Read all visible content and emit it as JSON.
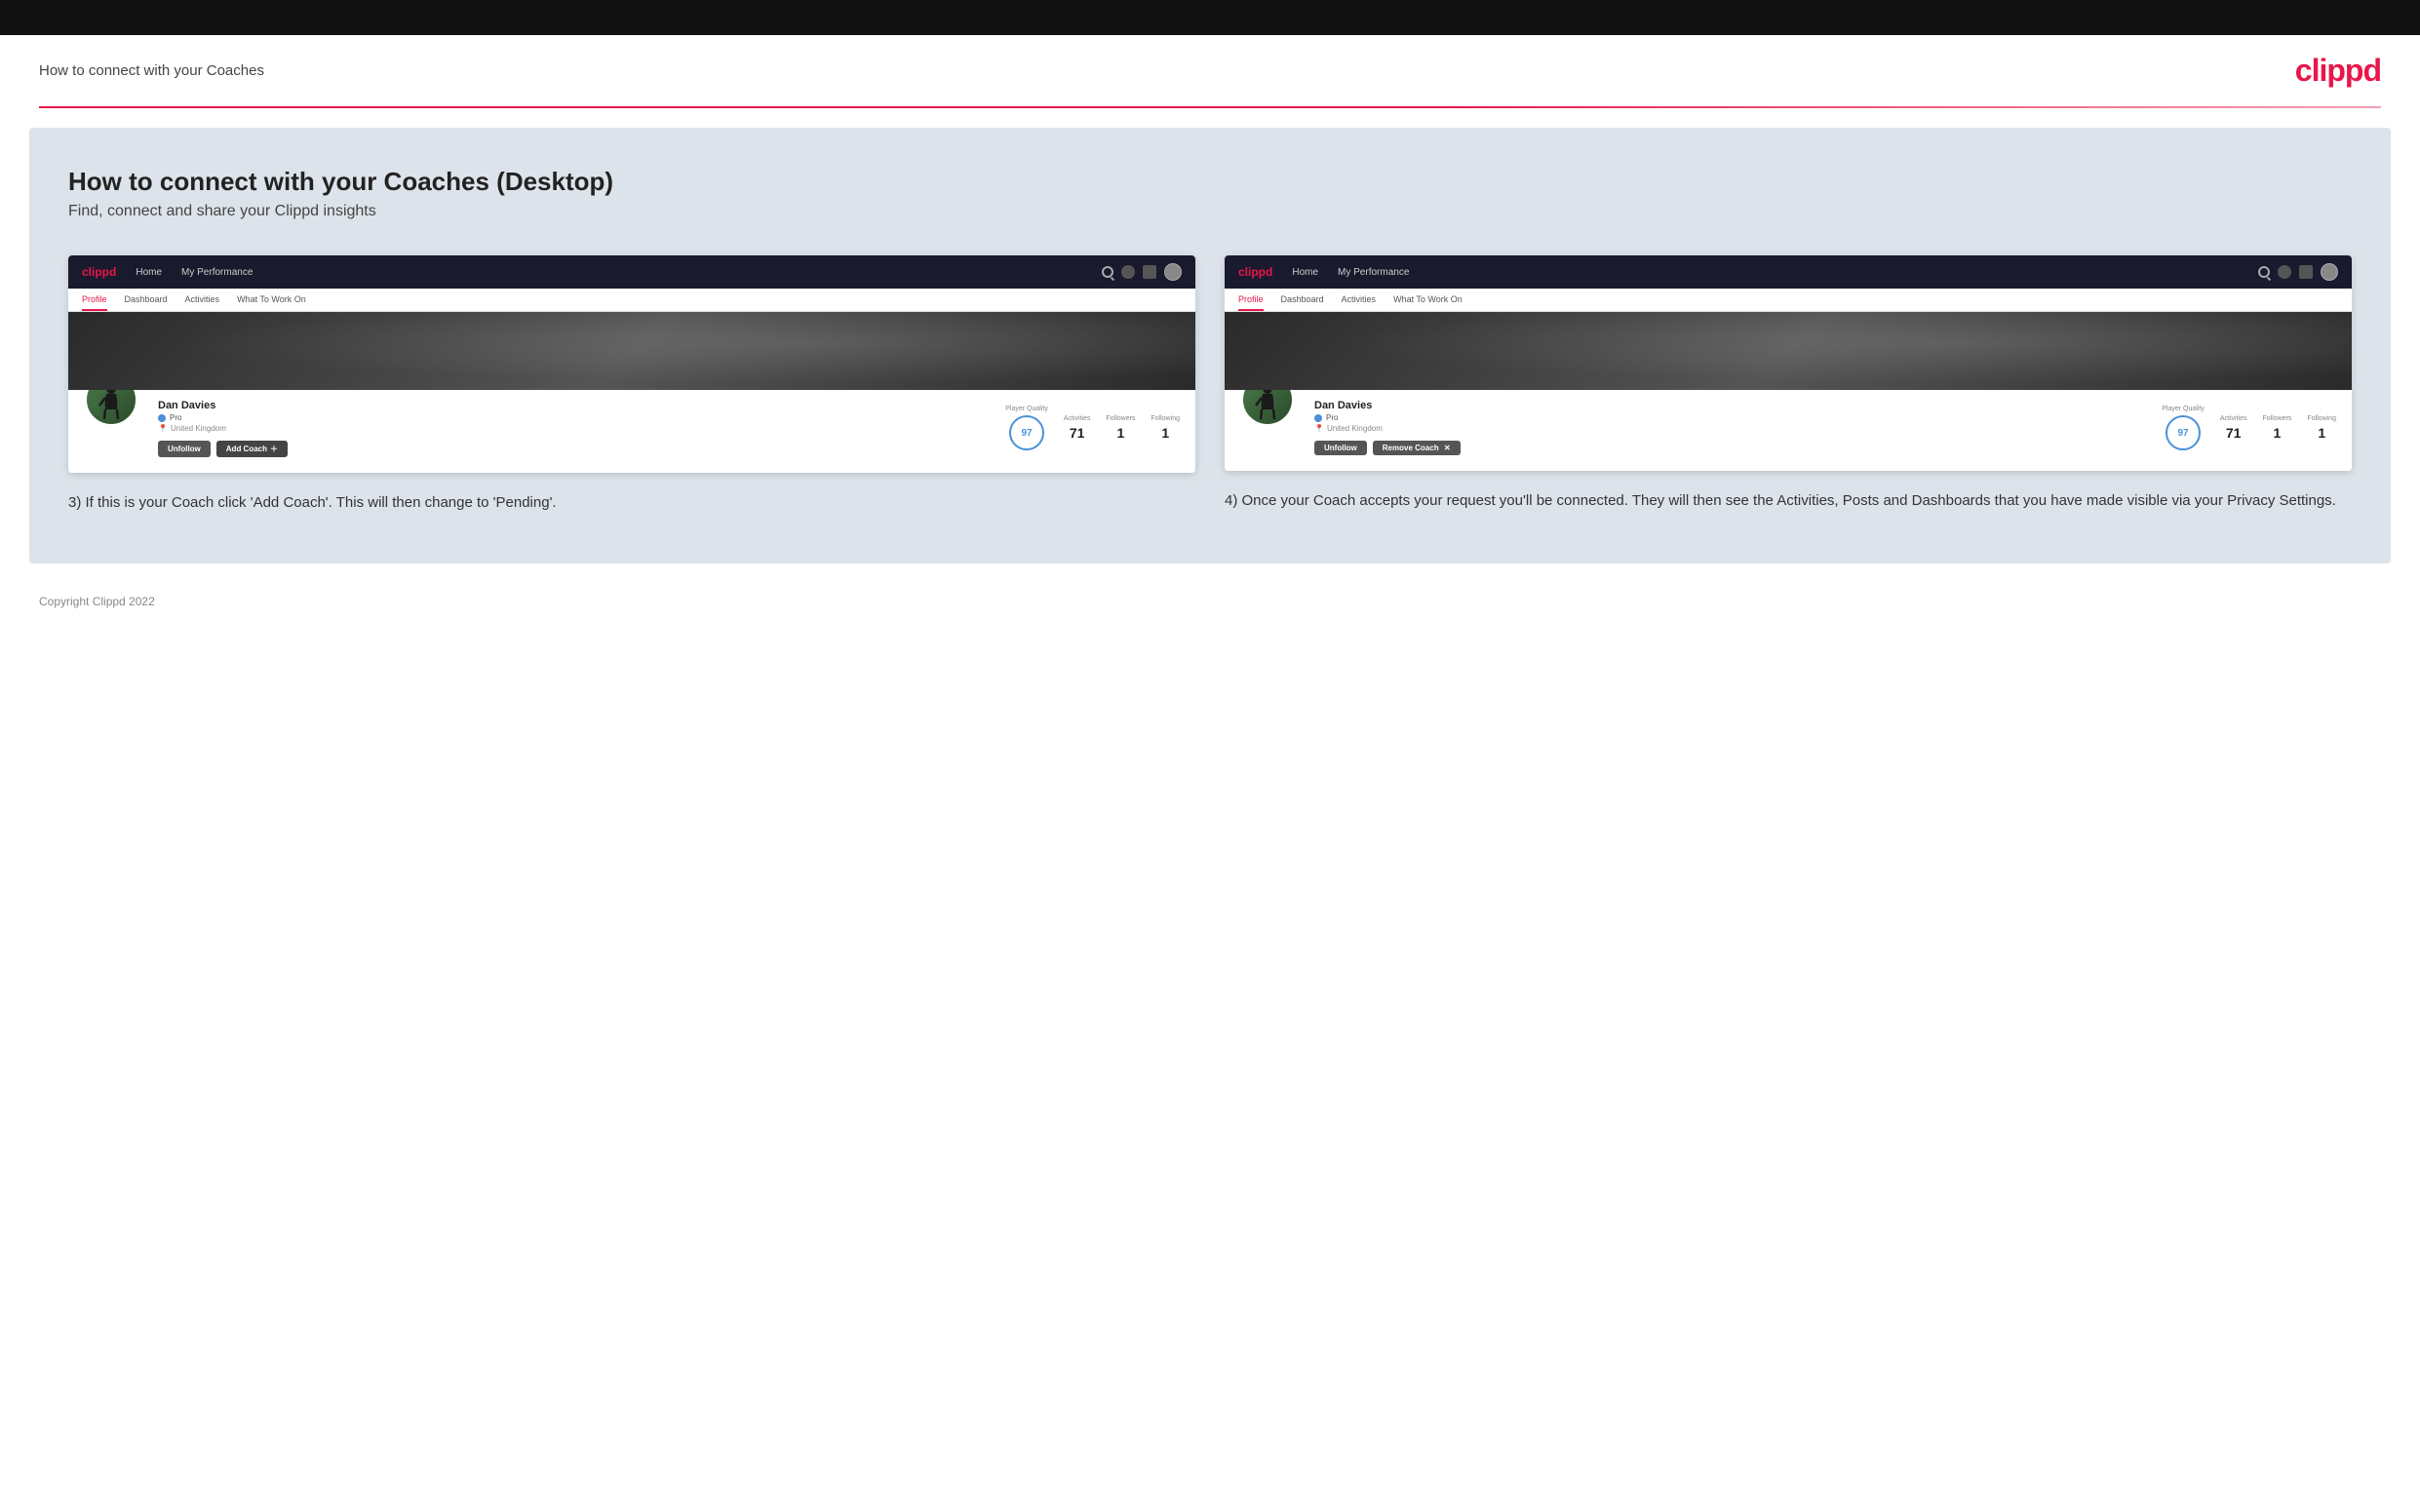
{
  "topBar": {},
  "header": {
    "title": "How to connect with your Coaches",
    "logo": "clippd"
  },
  "main": {
    "title": "How to connect with your Coaches (Desktop)",
    "subtitle": "Find, connect and share your Clippd insights",
    "columns": [
      {
        "id": "col-left",
        "mockBrowser": {
          "nav": {
            "logo": "clippd",
            "items": [
              "Home",
              "My Performance"
            ]
          },
          "tabs": [
            {
              "label": "Profile",
              "active": true
            },
            {
              "label": "Dashboard",
              "active": false
            },
            {
              "label": "Activities",
              "active": false
            },
            {
              "label": "What To Work On",
              "active": false
            }
          ],
          "profile": {
            "name": "Dan Davies",
            "badge": "Pro",
            "location": "United Kingdom",
            "stats": {
              "playerQuality": {
                "label": "Player Quality",
                "value": "97"
              },
              "activities": {
                "label": "Activities",
                "value": "71"
              },
              "followers": {
                "label": "Followers",
                "value": "1"
              },
              "following": {
                "label": "Following",
                "value": "1"
              }
            },
            "buttons": {
              "unfollow": "Unfollow",
              "addCoach": "Add Coach"
            }
          }
        },
        "description": "3) If this is your Coach click 'Add Coach'. This will then change to 'Pending'."
      },
      {
        "id": "col-right",
        "mockBrowser": {
          "nav": {
            "logo": "clippd",
            "items": [
              "Home",
              "My Performance"
            ]
          },
          "tabs": [
            {
              "label": "Profile",
              "active": true
            },
            {
              "label": "Dashboard",
              "active": false
            },
            {
              "label": "Activities",
              "active": false
            },
            {
              "label": "What To Work On",
              "active": false
            }
          ],
          "profile": {
            "name": "Dan Davies",
            "badge": "Pro",
            "location": "United Kingdom",
            "stats": {
              "playerQuality": {
                "label": "Player Quality",
                "value": "97"
              },
              "activities": {
                "label": "Activities",
                "value": "71"
              },
              "followers": {
                "label": "Followers",
                "value": "1"
              },
              "following": {
                "label": "Following",
                "value": "1"
              }
            },
            "buttons": {
              "unfollow": "Unfollow",
              "removeCoach": "Remove Coach"
            }
          }
        },
        "description": "4) Once your Coach accepts your request you'll be connected. They will then see the Activities, Posts and Dashboards that you have made visible via your Privacy Settings."
      }
    ]
  },
  "footer": {
    "copyright": "Copyright Clippd 2022"
  }
}
